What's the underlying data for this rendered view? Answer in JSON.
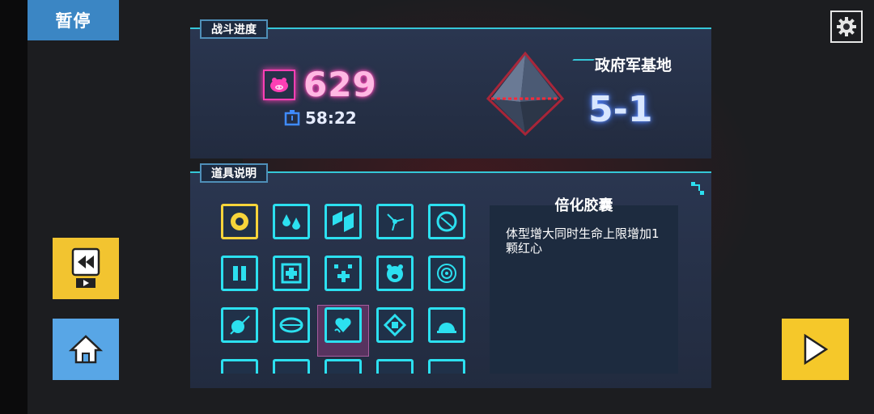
{
  "pause": {
    "label": "暂停"
  },
  "progress_panel": {
    "tab_label": "战斗进度",
    "score": "629",
    "time": "58:22",
    "stage_name": "政府军基地",
    "stage_level": "5-1"
  },
  "items_panel": {
    "tab_label": "道具说明",
    "selected_item": {
      "title": "倍化胶囊",
      "description": "体型增大同时生命上限增加1颗红心"
    }
  },
  "colors": {
    "accent_cyan": "#2ce0f0",
    "score_pink": "#ff3fb4",
    "panel_bg": "#222b3f",
    "yellow": "#f5c82a",
    "blue": "#58a6e6"
  },
  "icons": {
    "settings": "gear-icon",
    "replay": "video-rewind-icon",
    "home": "home-icon",
    "play": "play-icon",
    "score": "pig-target-icon",
    "time": "stopwatch-icon"
  }
}
